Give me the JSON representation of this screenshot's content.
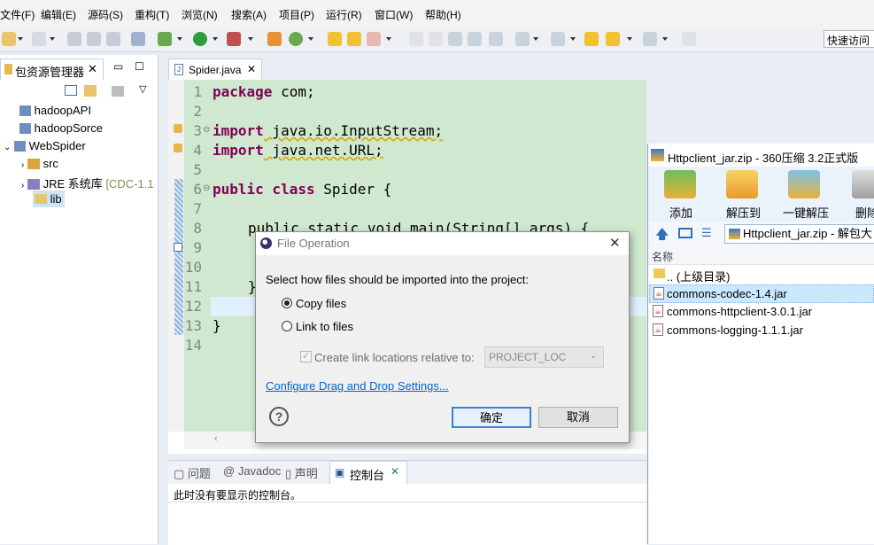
{
  "menu": [
    "文件(F)",
    "编辑(E)",
    "源码(S)",
    "重构(T)",
    "浏览(N)",
    "搜索(A)",
    "项目(P)",
    "运行(R)",
    "窗口(W)",
    "帮助(H)"
  ],
  "quick_access": "快速访问",
  "package_explorer": {
    "tab_label": "包资源管理器",
    "tree": [
      {
        "label": "hadoopAPI",
        "icon": "project-icon"
      },
      {
        "label": "hadoopSorce",
        "icon": "project-icon"
      },
      {
        "label": "WebSpider",
        "icon": "project-icon"
      },
      {
        "label": "src",
        "icon": "package-folder-icon"
      },
      {
        "label": "JRE 系统库",
        "suffix": "[CDC-1.1",
        "icon": "library-icon"
      },
      {
        "label": "lib",
        "icon": "folder-icon"
      }
    ]
  },
  "editor": {
    "tab_label": "Spider.java",
    "line_numbers": [
      "1",
      "2",
      "3",
      "4",
      "5",
      "6",
      "7",
      "8",
      "9",
      "10",
      "11",
      "12",
      "13",
      "14"
    ],
    "lines": {
      "l1_kw": "package",
      "l1_rest": " com;",
      "l3_kw": "import",
      "l3_rest": " java.io.InputStream;",
      "l4_kw": "import",
      "l4_rest": " java.net.URL;",
      "l6_kw": "public class",
      "l6_rest": " Spider {",
      "l8": "public static void main(String[] args) {",
      "l11": "}",
      "l13": "}"
    }
  },
  "console": {
    "tabs": [
      "问题",
      "Javadoc",
      "声明",
      "控制台"
    ],
    "message": "此时没有要显示的控制台。"
  },
  "zip_window": {
    "title": "Httpclient_jar.zip - 360压缩 3.2正式版",
    "tools": [
      "添加",
      "解压到",
      "一键解压",
      "删除"
    ],
    "address": "Httpclient_jar.zip - 解包大",
    "column_name": "名称",
    "files": [
      {
        "name": ".. (上级目录)",
        "icon": "folder-icon",
        "selected": false
      },
      {
        "name": "commons-codec-1.4.jar",
        "icon": "jar-icon",
        "selected": true
      },
      {
        "name": "commons-httpclient-3.0.1.jar",
        "icon": "jar-icon",
        "selected": false
      },
      {
        "name": "commons-logging-1.1.1.jar",
        "icon": "jar-icon",
        "selected": false
      }
    ]
  },
  "dialog": {
    "title": "File Operation",
    "prompt": "Select how files should be imported into the project:",
    "option_copy": "Copy files",
    "option_link": "Link to files",
    "selected_option": "copy",
    "checkbox_label": "Create link locations relative to:",
    "checkbox_checked": true,
    "combo_value": "PROJECT_LOC",
    "link_text": "Configure Drag and Drop Settings...",
    "ok_label": "确定",
    "cancel_label": "取消"
  },
  "colors": {
    "editor_bg": "#cfe8cf",
    "keyword": "#7f0055",
    "selection": "#cce8ff",
    "link": "#0066cc"
  }
}
